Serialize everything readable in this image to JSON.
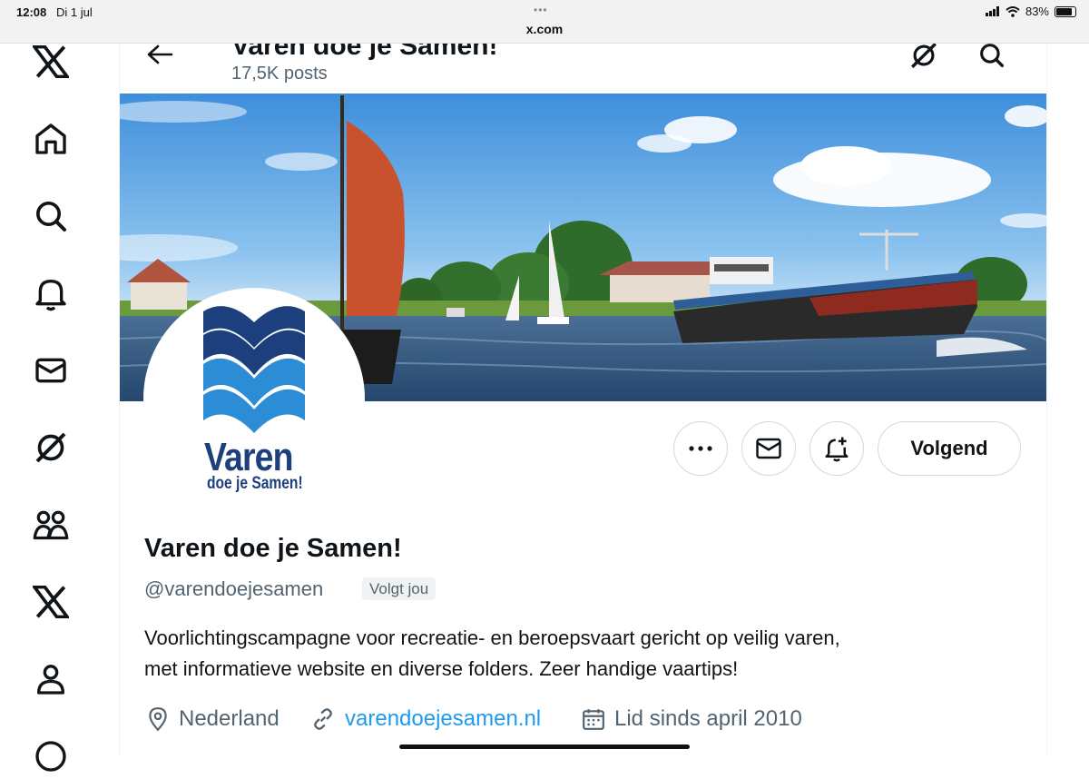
{
  "status_bar": {
    "time": "12:08",
    "date": "Di 1 jul",
    "url": "x.com",
    "battery": "83%",
    "battery_level": 0.83
  },
  "nav": {
    "items": [
      {
        "name": "x-logo-icon"
      },
      {
        "name": "home-icon"
      },
      {
        "name": "search-icon"
      },
      {
        "name": "notifications-bell-icon"
      },
      {
        "name": "messages-envelope-icon"
      },
      {
        "name": "grok-icon"
      },
      {
        "name": "communities-icon"
      },
      {
        "name": "premium-x-icon"
      },
      {
        "name": "profile-icon"
      }
    ]
  },
  "header": {
    "title": "Varen doe je Samen!",
    "posts_count": "17,5K posts"
  },
  "profile": {
    "logo_line1": "Varen",
    "logo_line2": "doe je Samen!",
    "display_name": "Varen doe je Samen!",
    "handle": "@varendoejesamen",
    "follows_you_badge": "Volgt jou",
    "bio_line1": "Voorlichtingscampagne voor recreatie- en beroepsvaart gericht op veilig varen,",
    "bio_line2": "met informatieve website en diverse folders. Zeer handige vaartips!",
    "location": "Nederland",
    "website": "varendoejesamen.nl",
    "joined": "Lid sinds april 2010"
  },
  "actions": {
    "follow_label": "Volgend"
  },
  "colors": {
    "link": "#1d9bf0",
    "muted": "#536471",
    "logo_navy": "#1d3f7d",
    "logo_blue": "#2c8dd6"
  }
}
